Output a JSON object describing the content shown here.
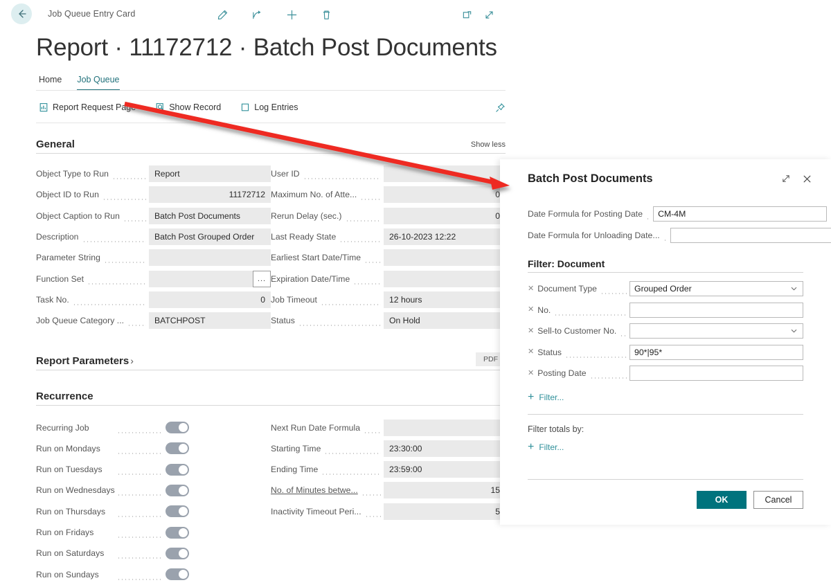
{
  "topbar": {
    "back_icon": "arrow-left-icon",
    "breadcrumb": "Job Queue Entry Card",
    "actions": [
      {
        "name": "edit-icon",
        "label": "Edit"
      },
      {
        "name": "share-icon",
        "label": "Share"
      },
      {
        "name": "plus-icon",
        "label": "New"
      },
      {
        "name": "trash-icon",
        "label": "Delete"
      }
    ],
    "right_actions": [
      {
        "name": "open-in-new-window-icon",
        "label": "Open in new window"
      },
      {
        "name": "expand-icon",
        "label": "Expand"
      }
    ]
  },
  "page": {
    "title": "Report · 11172712 · Batch Post Documents"
  },
  "tabs": [
    {
      "label": "Home",
      "active": false
    },
    {
      "label": "Job Queue",
      "active": true
    }
  ],
  "ribbon": {
    "items": [
      {
        "icon": "report-request-page-icon",
        "label": "Report Request Page"
      },
      {
        "icon": "show-record-icon",
        "label": "Show Record"
      },
      {
        "icon": "log-entries-icon",
        "label": "Log Entries"
      }
    ],
    "pin_icon": "pin-icon"
  },
  "general": {
    "title": "General",
    "show_less": "Show less",
    "left_fields": [
      {
        "label": "Object Type to Run",
        "value": "Report",
        "align": "left"
      },
      {
        "label": "Object ID to Run",
        "value": "11172712",
        "align": "right"
      },
      {
        "label": "Object Caption to Run",
        "value": "Batch Post Documents",
        "align": "left"
      },
      {
        "label": "Description",
        "value": "Batch Post Grouped Order",
        "align": "left"
      },
      {
        "label": "Parameter String",
        "value": "",
        "align": "left"
      },
      {
        "label": "Function Set",
        "value": "",
        "align": "left",
        "lookup": true,
        "lookup_label": "..."
      },
      {
        "label": "Task No.",
        "value": "0",
        "align": "right"
      },
      {
        "label": "Job Queue Category ...",
        "value": "BATCHPOST",
        "align": "left"
      }
    ],
    "right_fields": [
      {
        "label": "User ID",
        "value": "",
        "align": "left"
      },
      {
        "label": "Maximum No. of Atte...",
        "value": "0",
        "align": "right"
      },
      {
        "label": "Rerun Delay (sec.)",
        "value": "0",
        "align": "right"
      },
      {
        "label": "Last Ready State",
        "value": "26-10-2023 12:22",
        "align": "left"
      },
      {
        "label": "Earliest Start Date/Time",
        "value": "",
        "align": "left"
      },
      {
        "label": "Expiration Date/Time",
        "value": "",
        "align": "left"
      },
      {
        "label": "Job Timeout",
        "value": "12 hours",
        "align": "left"
      },
      {
        "label": "Status",
        "value": "On Hold",
        "align": "left"
      }
    ]
  },
  "report_parameters": {
    "title": "Report Parameters",
    "chevron": "›",
    "format_badge": "PDF"
  },
  "recurrence": {
    "title": "Recurrence",
    "toggles": [
      {
        "label": "Recurring Job",
        "on": true
      },
      {
        "label": "Run on Mondays",
        "on": true
      },
      {
        "label": "Run on Tuesdays",
        "on": true
      },
      {
        "label": "Run on Wednesdays",
        "on": true
      },
      {
        "label": "Run on Thursdays",
        "on": true
      },
      {
        "label": "Run on Fridays",
        "on": true
      },
      {
        "label": "Run on Saturdays",
        "on": true
      },
      {
        "label": "Run on Sundays",
        "on": true
      }
    ],
    "right_fields": [
      {
        "label": "Next Run Date Formula",
        "value": "",
        "align": "left",
        "underline": false
      },
      {
        "label": "Starting Time",
        "value": "23:30:00",
        "align": "left",
        "underline": false
      },
      {
        "label": "Ending Time",
        "value": "23:59:00",
        "align": "left",
        "underline": false
      },
      {
        "label": "No. of Minutes betwe...",
        "value": "15",
        "align": "right",
        "underline": true
      },
      {
        "label": "Inactivity Timeout Peri...",
        "value": "5",
        "align": "right",
        "underline": false
      }
    ]
  },
  "dialog": {
    "title": "Batch Post Documents",
    "expand_icon": "expand-icon",
    "close_icon": "close-icon",
    "top_fields": [
      {
        "label": "Date Formula for Posting Date",
        "value": "CM-4M",
        "dropdown": false
      },
      {
        "label": "Date Formula for Unloading Date...",
        "value": "",
        "dropdown": false
      }
    ],
    "filter_section_title": "Filter: Document",
    "filters": [
      {
        "label": "Document Type",
        "value": "Grouped Order",
        "dropdown": true
      },
      {
        "label": "No.",
        "value": "",
        "dropdown": false
      },
      {
        "label": "Sell-to Customer No.",
        "value": "",
        "dropdown": true
      },
      {
        "label": "Status",
        "value": "90*|95*",
        "dropdown": false
      },
      {
        "label": "Posting Date",
        "value": "",
        "dropdown": false
      }
    ],
    "add_filter_label": "Filter...",
    "filter_totals_label": "Filter totals by:",
    "add_filter_totals_label": "Filter...",
    "ok_label": "OK",
    "cancel_label": "Cancel"
  },
  "colors": {
    "accent": "#2e8f99",
    "primary_button": "#00737d",
    "tab_active": "#22727c",
    "annotation_arrow": "#ee2b20",
    "field_background": "#eaeaea"
  },
  "annotation": {
    "type": "arrow",
    "description": "red arrow from Report Request Page to Batch Post Documents dialog"
  }
}
